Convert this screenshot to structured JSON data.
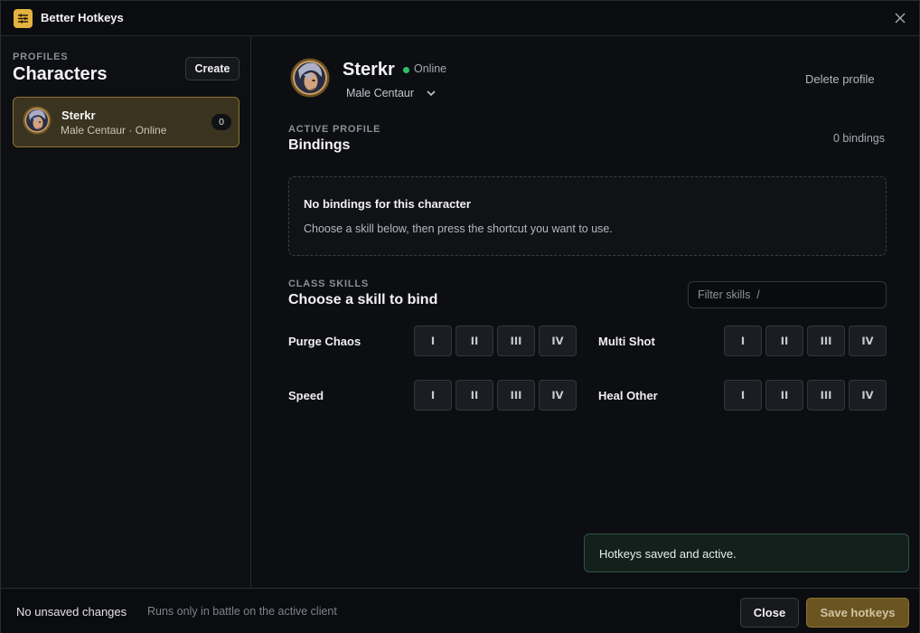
{
  "app": {
    "title": "Better Hotkeys",
    "icon": "sliders-icon",
    "accent_color": "#e5b23f"
  },
  "sidebar": {
    "kicker": "PROFILES",
    "heading": "Characters",
    "create_label": "Create",
    "characters": [
      {
        "name": "Sterkr",
        "subtitle": "Male Centaur · Online",
        "binding_count": "0",
        "selected": true
      }
    ]
  },
  "profile": {
    "name": "Sterkr",
    "status": "Online",
    "status_color": "#2fbf68",
    "class_selected": "Male Centaur",
    "delete_label": "Delete profile"
  },
  "bindings": {
    "kicker": "ACTIVE PROFILE",
    "heading": "Bindings",
    "count_label": "0 bindings",
    "empty_title": "No bindings for this character",
    "empty_desc": "Choose a skill below, then press the shortcut you want to use."
  },
  "skills": {
    "kicker": "CLASS SKILLS",
    "heading": "Choose a skill to bind",
    "filter_placeholder": "Filter skills  /",
    "rank_labels": [
      "I",
      "II",
      "III",
      "IV"
    ],
    "items": [
      {
        "name": "Purge Chaos"
      },
      {
        "name": "Multi Shot"
      },
      {
        "name": "Speed"
      },
      {
        "name": "Heal Other"
      }
    ]
  },
  "toast": {
    "message": "Hotkeys saved and active."
  },
  "footer": {
    "status": "No unsaved changes",
    "note": "Runs only in battle on the active client",
    "close_label": "Close",
    "save_label": "Save hotkeys"
  }
}
